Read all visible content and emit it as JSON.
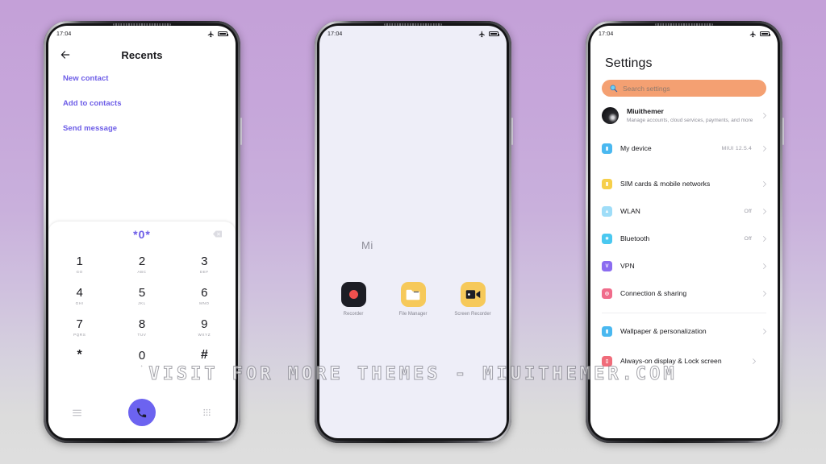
{
  "background": {
    "top_color": "#c4a0d8",
    "bottom_color": "#dedede"
  },
  "watermark": {
    "text": "VISIT  FOR  MORE  THEMES  -  MIUITHEMER.COM"
  },
  "status_bar": {
    "time": "17:04",
    "airplane_icon": "airplane-mode-icon",
    "battery_icon": "battery-full-icon"
  },
  "phone1": {
    "app": "Dialer",
    "header": {
      "title": "Recents",
      "back_icon": "back-arrow-icon"
    },
    "quick_actions": [
      {
        "label": "New contact"
      },
      {
        "label": "Add to contacts"
      },
      {
        "label": "Send message"
      }
    ],
    "dialpad": {
      "number": "*0*",
      "backspace_icon": "backspace-icon",
      "keys": [
        {
          "digit": "1",
          "letters": "GO"
        },
        {
          "digit": "2",
          "letters": "ABC"
        },
        {
          "digit": "3",
          "letters": "DEF"
        },
        {
          "digit": "4",
          "letters": "GHI"
        },
        {
          "digit": "5",
          "letters": "JKL"
        },
        {
          "digit": "6",
          "letters": "MNO"
        },
        {
          "digit": "7",
          "letters": "PQRS"
        },
        {
          "digit": "8",
          "letters": "TUV"
        },
        {
          "digit": "9",
          "letters": "WXYZ"
        },
        {
          "digit": "*",
          "letters": ""
        },
        {
          "digit": "0",
          "letters": "+"
        },
        {
          "digit": "#",
          "letters": ""
        }
      ],
      "footer": {
        "menu_icon": "menu-icon",
        "call_icon": "call-icon",
        "call_button_color": "#6c63f0",
        "keypad_icon": "keypad-icon"
      }
    }
  },
  "phone2": {
    "folder_name": "Mi",
    "apps": [
      {
        "label": "Recorder",
        "icon": "recorder-icon",
        "color": "#1c1d25"
      },
      {
        "label": "File Manager",
        "icon": "folder-icon",
        "color": "#f6c95a"
      },
      {
        "label": "Screen Recorder",
        "icon": "video-camera-icon",
        "color": "#f6c95a"
      }
    ]
  },
  "phone3": {
    "title": "Settings",
    "search": {
      "placeholder": "Search settings",
      "icon": "search-icon",
      "color": "#f4a072"
    },
    "account": {
      "name": "Miuithemer",
      "subtitle": "Manage accounts, cloud services, payments, and more",
      "avatar": "avatar"
    },
    "rows": [
      {
        "label": "My device",
        "value": "MIUI 12.5.4",
        "icon": "device-icon",
        "color": "#4ab8f0"
      },
      {
        "label": "SIM cards & mobile networks",
        "value": "",
        "icon": "sim-card-icon",
        "color": "#f6cf4a"
      },
      {
        "label": "WLAN",
        "value": "Off",
        "icon": "wifi-icon",
        "color": "#8fd8f6"
      },
      {
        "label": "Bluetooth",
        "value": "Off",
        "icon": "bluetooth-icon",
        "color": "#4ac8f0"
      },
      {
        "label": "VPN",
        "value": "",
        "icon": "vpn-icon",
        "color": "#8b6cf0"
      },
      {
        "label": "Connection & sharing",
        "value": "",
        "icon": "connection-icon",
        "color": "#f06c8b"
      }
    ],
    "rows2": [
      {
        "label": "Wallpaper & personalization",
        "value": "",
        "icon": "wallpaper-icon",
        "color": "#4ab8f0"
      },
      {
        "label": "Always-on display & Lock screen",
        "value": "",
        "icon": "lock-screen-icon",
        "color": "#f06c7a"
      }
    ]
  }
}
